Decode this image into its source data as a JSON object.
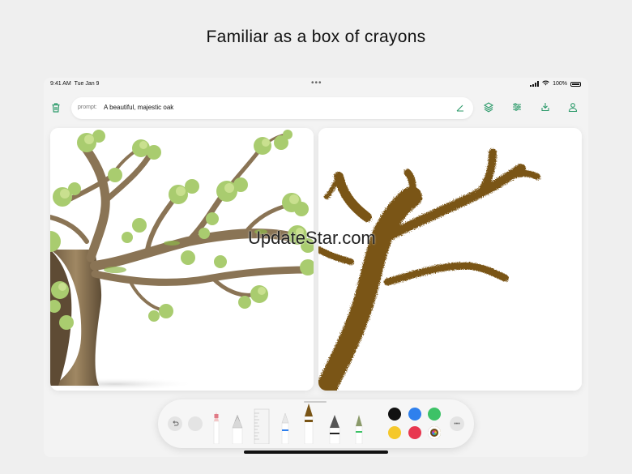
{
  "headline": "Familiar as a box of crayons",
  "status_bar": {
    "time": "9:41 AM",
    "date": "Tue Jan 9",
    "battery": "100%",
    "more_dots": "•••"
  },
  "prompt": {
    "label": "prompt:",
    "value": "A beautiful, majestic oak"
  },
  "top_actions": [
    "trash-icon",
    "layers-icon",
    "sliders-icon",
    "download-icon",
    "person-icon"
  ],
  "watermark": "UpdateStar.com",
  "tools": [
    "pencil",
    "fountain-tip",
    "ruler",
    "marker",
    "crayon",
    "fountain-pen",
    "brush"
  ],
  "palette": {
    "colors": [
      "#111111",
      "#2f80ed",
      "#3dc267",
      "#f5c82b",
      "#e8374f"
    ],
    "selected": "multicolor"
  },
  "more_button": "•••"
}
